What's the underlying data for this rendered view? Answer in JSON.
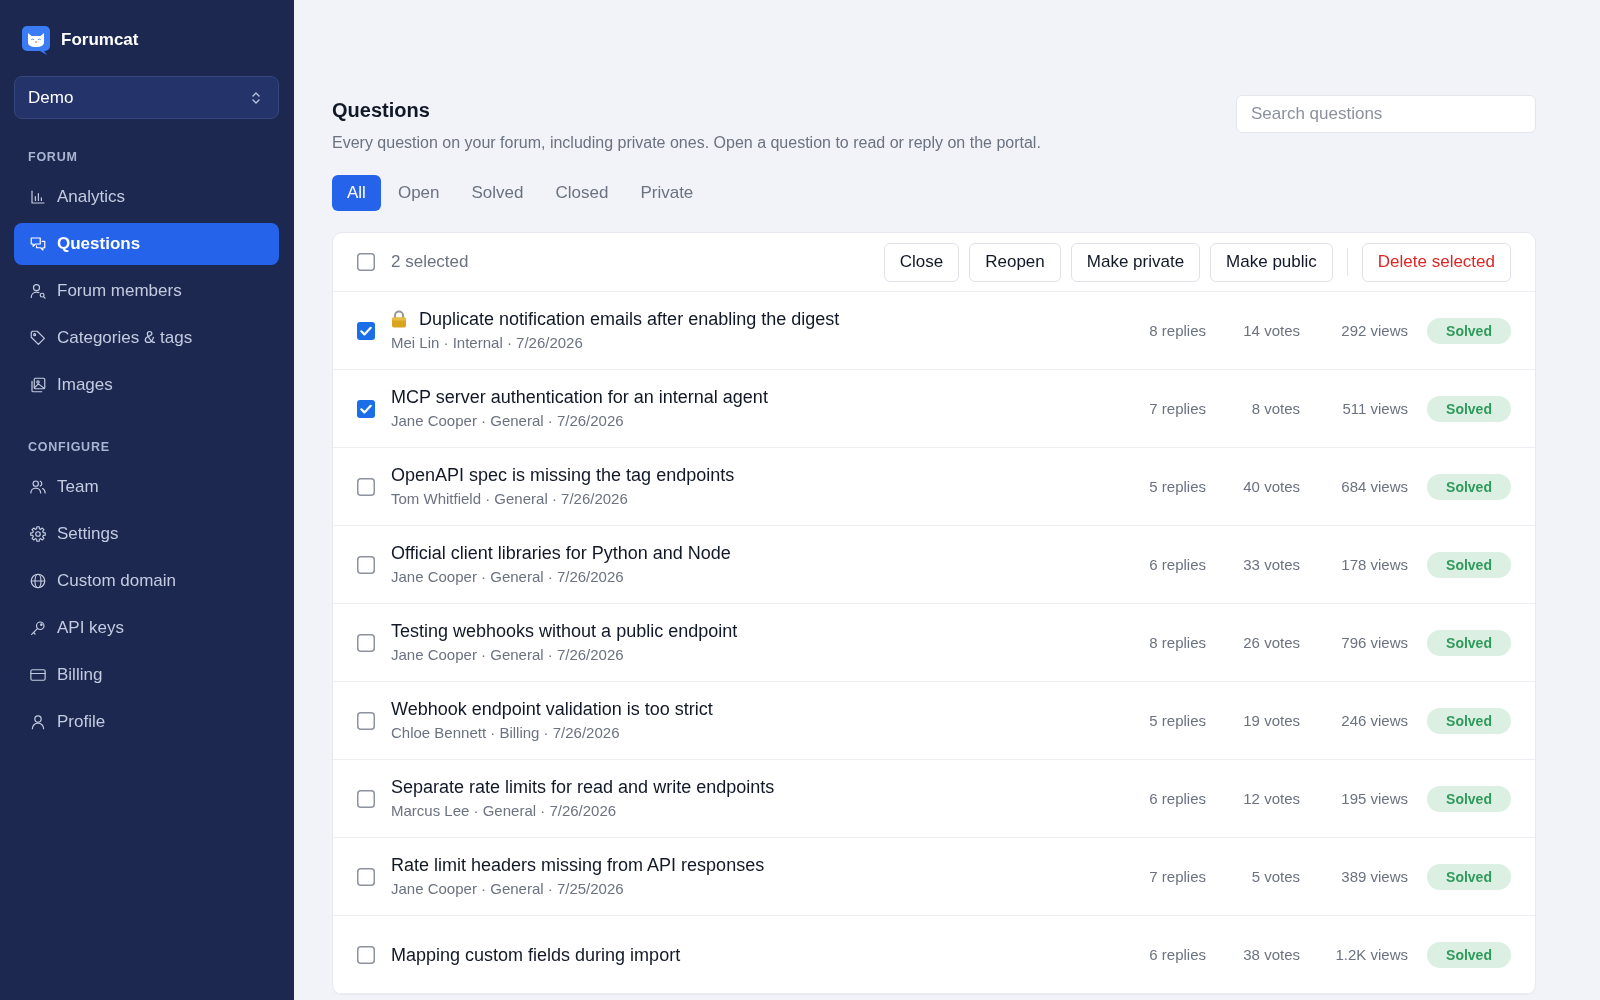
{
  "sidebar": {
    "brand": "Forumcat",
    "workspace": "Demo",
    "sections": [
      {
        "label": "FORUM",
        "items": [
          {
            "label": "Analytics",
            "selected": false
          },
          {
            "label": "Questions",
            "selected": true
          },
          {
            "label": "Forum members",
            "selected": false
          },
          {
            "label": "Categories & tags",
            "selected": false
          },
          {
            "label": "Images",
            "selected": false
          }
        ]
      },
      {
        "label": "CONFIGURE",
        "items": [
          {
            "label": "Team",
            "selected": false
          },
          {
            "label": "Settings",
            "selected": false
          },
          {
            "label": "Custom domain",
            "selected": false
          },
          {
            "label": "API keys",
            "selected": false
          },
          {
            "label": "Billing",
            "selected": false
          },
          {
            "label": "Profile",
            "selected": false
          }
        ]
      }
    ]
  },
  "header": {
    "title": "Questions",
    "description": "Every question on your forum, including private ones. Open a question to read or reply on the portal.",
    "search": {
      "placeholder": "Search questions"
    }
  },
  "tabs": [
    {
      "label": "All",
      "selected": true
    },
    {
      "label": "Open",
      "selected": false
    },
    {
      "label": "Solved",
      "selected": false
    },
    {
      "label": "Closed",
      "selected": false
    },
    {
      "label": "Private",
      "selected": false
    }
  ],
  "toolbar": {
    "checked": false,
    "selection": "2 selected",
    "actions": [
      {
        "label": "Close",
        "kind": "default"
      },
      {
        "label": "Reopen",
        "kind": "default"
      },
      {
        "label": "Make private",
        "kind": "default"
      },
      {
        "label": "Make public",
        "kind": "default"
      },
      {
        "label": "Delete selected",
        "kind": "danger"
      }
    ]
  },
  "questions": [
    {
      "checked": true,
      "private": true,
      "title": "Duplicate notification emails after enabling the digest",
      "meta": "Mei Lin · Internal · 7/26/2026",
      "replies": "8 replies",
      "votes": "14 votes",
      "views": "292 views",
      "status": {
        "label": "Solved",
        "kind": "solved"
      }
    },
    {
      "checked": true,
      "private": false,
      "title": "MCP server authentication for an internal agent",
      "meta": "Jane Cooper · General · 7/26/2026",
      "replies": "7 replies",
      "votes": "8 votes",
      "views": "511 views",
      "status": {
        "label": "Solved",
        "kind": "solved"
      }
    },
    {
      "checked": false,
      "private": false,
      "title": "OpenAPI spec is missing the tag endpoints",
      "meta": "Tom Whitfield · General · 7/26/2026",
      "replies": "5 replies",
      "votes": "40 votes",
      "views": "684 views",
      "status": {
        "label": "Solved",
        "kind": "solved"
      }
    },
    {
      "checked": false,
      "private": false,
      "title": "Official client libraries for Python and Node",
      "meta": "Jane Cooper · General · 7/26/2026",
      "replies": "6 replies",
      "votes": "33 votes",
      "views": "178 views",
      "status": {
        "label": "Solved",
        "kind": "solved"
      }
    },
    {
      "checked": false,
      "private": false,
      "title": "Testing webhooks without a public endpoint",
      "meta": "Jane Cooper · General · 7/26/2026",
      "replies": "8 replies",
      "votes": "26 votes",
      "views": "796 views",
      "status": {
        "label": "Solved",
        "kind": "solved"
      }
    },
    {
      "checked": false,
      "private": false,
      "title": "Webhook endpoint validation is too strict",
      "meta": "Chloe Bennett · Billing · 7/26/2026",
      "replies": "5 replies",
      "votes": "19 votes",
      "views": "246 views",
      "status": {
        "label": "Solved",
        "kind": "solved"
      }
    },
    {
      "checked": false,
      "private": false,
      "title": "Separate rate limits for read and write endpoints",
      "meta": "Marcus Lee · General · 7/26/2026",
      "replies": "6 replies",
      "votes": "12 votes",
      "views": "195 views",
      "status": {
        "label": "Solved",
        "kind": "solved"
      }
    },
    {
      "checked": false,
      "private": false,
      "title": "Rate limit headers missing from API responses",
      "meta": "Jane Cooper · General · 7/25/2026",
      "replies": "7 replies",
      "votes": "5 votes",
      "views": "389 views",
      "status": {
        "label": "Solved",
        "kind": "solved"
      }
    },
    {
      "checked": false,
      "private": false,
      "title": "Mapping custom fields during import",
      "replies": "6 replies",
      "votes": "38 votes",
      "views": "1.2K views",
      "status": {
        "label": "Solved",
        "kind": "solved"
      }
    }
  ]
}
